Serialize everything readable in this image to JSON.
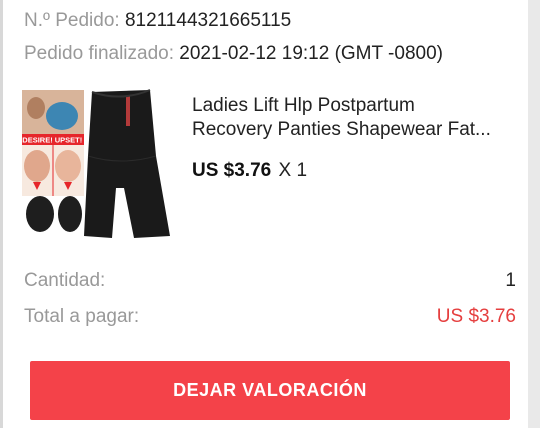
{
  "order": {
    "number_label": "N.º Pedido:",
    "number_value": "8121144321665115",
    "completed_label": "Pedido finalizado:",
    "completed_value": "2021-02-12 19:12 (GMT -0800)"
  },
  "product": {
    "title_line1": "Ladies Lift Hlp Postpartum",
    "title_line2": "Recovery Panties Shapewear Fat...",
    "price": "US $3.76",
    "quantity_text": "X 1",
    "image_banner_left": "DESIRE!",
    "image_banner_right": "UPSET!"
  },
  "summary": {
    "quantity_label": "Cantidad:",
    "quantity_value": "1",
    "total_label": "Total a pagar:",
    "total_value": "US $3.76"
  },
  "actions": {
    "review_button": "DEJAR VALORACIÓN"
  },
  "colors": {
    "accent": "#f44249",
    "total": "#e53e3e"
  }
}
